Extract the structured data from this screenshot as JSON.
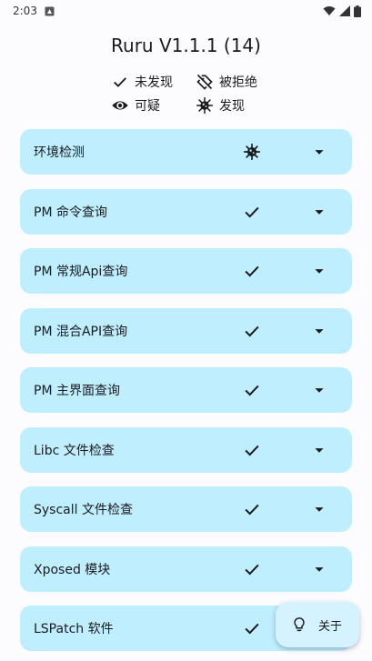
{
  "status_bar": {
    "time": "2:03"
  },
  "app": {
    "title": "Ruru V1.1.1 (14)"
  },
  "legend": {
    "not_found": "未发现",
    "rejected": "被拒绝",
    "suspicious": "可疑",
    "found": "发现"
  },
  "checks": [
    {
      "label": "环境检测",
      "status": "found"
    },
    {
      "label": "PM 命令查询",
      "status": "not_found"
    },
    {
      "label": "PM 常规Api查询",
      "status": "not_found"
    },
    {
      "label": "PM 混合API查询",
      "status": "not_found"
    },
    {
      "label": "PM 主界面查询",
      "status": "not_found"
    },
    {
      "label": "Libc 文件检查",
      "status": "not_found"
    },
    {
      "label": "Syscall 文件检查",
      "status": "not_found"
    },
    {
      "label": "Xposed 模块",
      "status": "not_found"
    },
    {
      "label": "LSPatch 软件",
      "status": "not_found"
    }
  ],
  "fab": {
    "label": "关于",
    "icon": "lightbulb-icon"
  },
  "colors": {
    "card_bg": "#bfeeff",
    "fab_bg": "#d4f2ff",
    "page_bg": "#fcfcff"
  }
}
